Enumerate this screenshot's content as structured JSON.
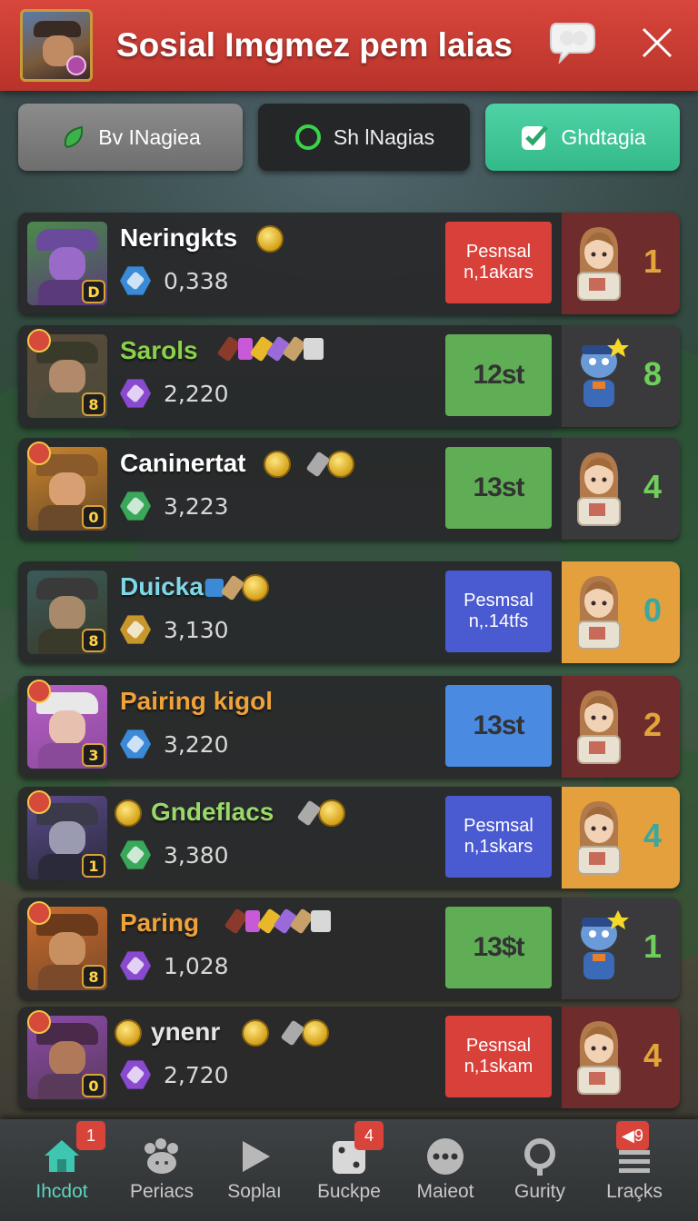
{
  "header": {
    "title": "Sosial Imgmez pem laias",
    "avatar_icon": "player-avatar",
    "chat_icon": "chat-bubble-icon",
    "close_icon": "close-icon"
  },
  "tabs": [
    {
      "label": "Bv INagiea",
      "icon": "leaf-icon",
      "color": "#7e7e7e"
    },
    {
      "label": "Sh lNagias",
      "icon": "ring-icon",
      "color": "#242628"
    },
    {
      "label": "Ghdtagia",
      "icon": "check-icon",
      "color": "#3fc596"
    }
  ],
  "players": [
    {
      "name": "Neringkts",
      "name_color": "#ffffff",
      "level": "D",
      "score": "0,338",
      "gem_color": "#3a8ad8",
      "status_main": "Pesnsal",
      "status_sub": "n,1akars",
      "status_color": "#d8413a",
      "rank": "1",
      "rank_color": "#e2a53a",
      "panel_color": "#6e2c2c",
      "figure": "girl"
    },
    {
      "name": "Sarols",
      "name_color": "#8bd04a",
      "level": "8",
      "score": "2,220",
      "gem_color": "#8a4ad0",
      "status_main": "12st",
      "status_sub": "",
      "status_color": "#5fae55",
      "rank": "8",
      "rank_color": "#6fcf5a",
      "panel_color": "#3a3a3c",
      "figure": "robot"
    },
    {
      "name": "Caninertat",
      "name_color": "#ffffff",
      "level": "0",
      "score": "3,223",
      "gem_color": "#3aa85a",
      "status_main": "13st",
      "status_sub": "",
      "status_color": "#5fae55",
      "rank": "4",
      "rank_color": "#6fcf5a",
      "panel_color": "#3a3a3c",
      "figure": "girl"
    },
    {
      "name": "Duickar",
      "name_color": "#7fd8e8",
      "level": "8",
      "score": "3,130",
      "gem_color": "#c8962a",
      "status_main": "Pesmsal",
      "status_sub": "n,.14tfs",
      "status_color": "#4a5ad0",
      "rank": "0",
      "rank_color": "#3aa8a0",
      "panel_color": "#e3a03c",
      "figure": "girl"
    },
    {
      "name": "Pairing kigol",
      "name_color": "#f0a23a",
      "level": "3",
      "score": "3,220",
      "gem_color": "#3a8ad8",
      "status_main": "13st",
      "status_sub": "",
      "status_color": "#4a8ae0",
      "rank": "2",
      "rank_color": "#e2a53a",
      "panel_color": "#6e2c2c",
      "figure": "girl"
    },
    {
      "name": "Gndeflacs",
      "name_color": "#9ad86a",
      "level": "1",
      "score": "3,380",
      "gem_color": "#3aa85a",
      "status_main": "Pesmsal",
      "status_sub": "n,1skars",
      "status_color": "#4a5ad0",
      "rank": "4",
      "rank_color": "#3aa8a0",
      "panel_color": "#e3a03c",
      "figure": "girl"
    },
    {
      "name": "Paring",
      "name_color": "#f0a23a",
      "level": "8",
      "score": "1,028",
      "gem_color": "#8a4ad0",
      "status_main": "13$t",
      "status_sub": "",
      "status_color": "#5fae55",
      "rank": "1",
      "rank_color": "#6fcf5a",
      "panel_color": "#3a3a3c",
      "figure": "robot"
    },
    {
      "name": "ynenr",
      "name_color": "#e6e6e6",
      "level": "0",
      "score": "2,720",
      "gem_color": "#8a4ad0",
      "status_main": "Pesnsal",
      "status_sub": "n,1skam",
      "status_color": "#d8413a",
      "rank": "4",
      "rank_color": "#e2a53a",
      "panel_color": "#6e2c2c",
      "figure": "girl"
    }
  ],
  "nav": [
    {
      "label": "Ihcdot",
      "icon": "home-icon",
      "badge": "1",
      "active": true
    },
    {
      "label": "Periacs",
      "icon": "paw-icon",
      "badge": ""
    },
    {
      "label": "Soplaı",
      "icon": "play-icon",
      "badge": ""
    },
    {
      "label": "Бuckpe",
      "icon": "dice-icon",
      "badge": "4"
    },
    {
      "label": "Maieot",
      "icon": "more-icon",
      "badge": ""
    },
    {
      "label": "Gurity",
      "icon": "search-icon",
      "badge": ""
    },
    {
      "label": "Lraçks",
      "icon": "menu-icon",
      "badge": "◀9"
    }
  ]
}
